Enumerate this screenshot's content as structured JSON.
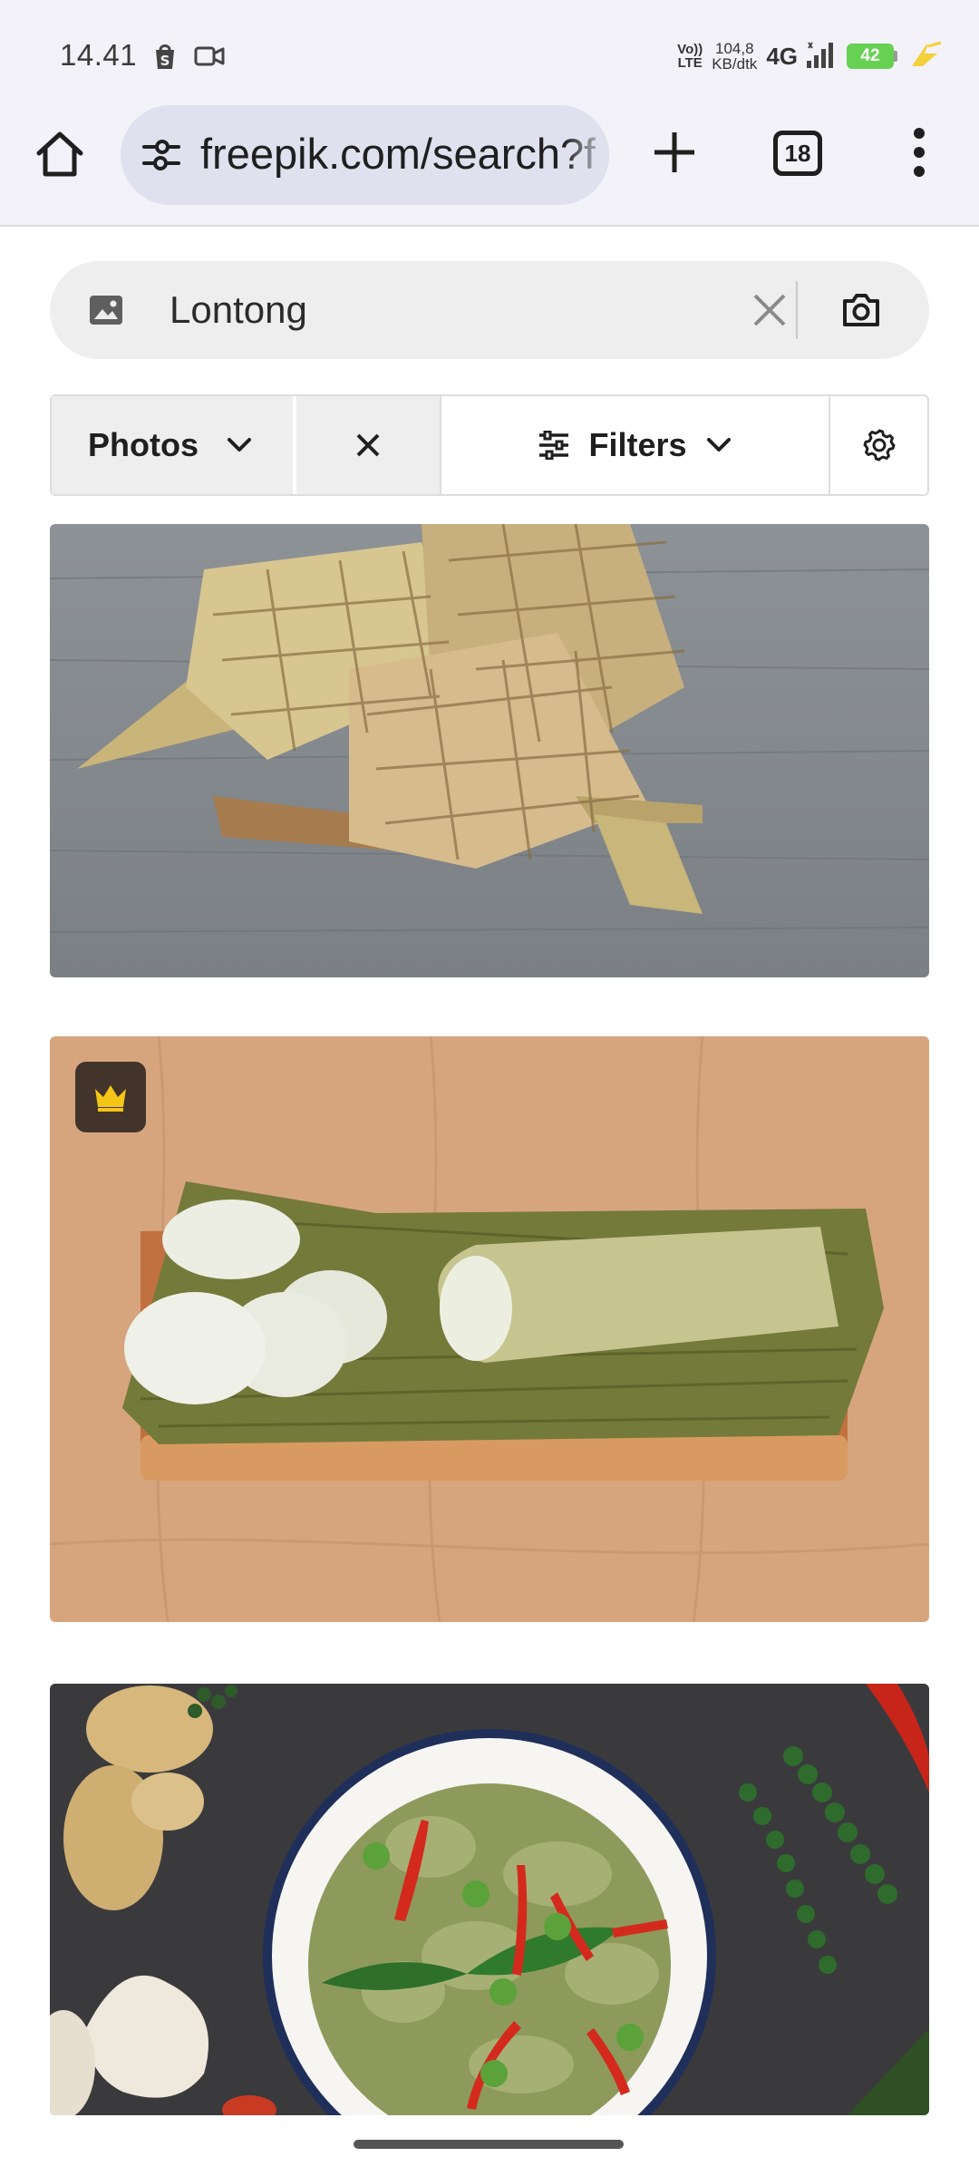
{
  "status_bar": {
    "time": "14.41",
    "network_label_top": "Vo))",
    "network_label_bottom": "LTE",
    "speed_value": "104,8",
    "speed_unit": "KB/dtk",
    "network_type": "4G",
    "battery_level": "42",
    "icons": [
      "shopee-notification-icon",
      "video-camera-icon",
      "signal-icon",
      "battery-icon",
      "charging-icon"
    ]
  },
  "browser": {
    "url": "freepik.com/search?format=search&query=Lontong",
    "tab_count": "18",
    "icons": [
      "home-icon",
      "site-settings-icon",
      "new-tab-icon",
      "tab-switcher-icon",
      "more-menu-icon"
    ]
  },
  "search": {
    "query": "Lontong",
    "icons": [
      "image-icon",
      "clear-icon",
      "camera-icon"
    ]
  },
  "filter_bar": {
    "type_label": "Photos",
    "filters_label": "Filters",
    "icons": [
      "chevron-down-icon",
      "close-icon",
      "sliders-icon",
      "settings-icon"
    ]
  },
  "results": [
    {
      "subject": "ketupat",
      "premium": false
    },
    {
      "subject": "lontong",
      "premium": true
    },
    {
      "subject": "green curry",
      "premium": false
    }
  ],
  "colors": {
    "chrome_bg": "#f2f2f8",
    "url_pill_bg": "#dfe1ee",
    "premium_crown": "#f5c518",
    "battery_green": "#66d152",
    "charging_yellow": "#f3d13b"
  }
}
